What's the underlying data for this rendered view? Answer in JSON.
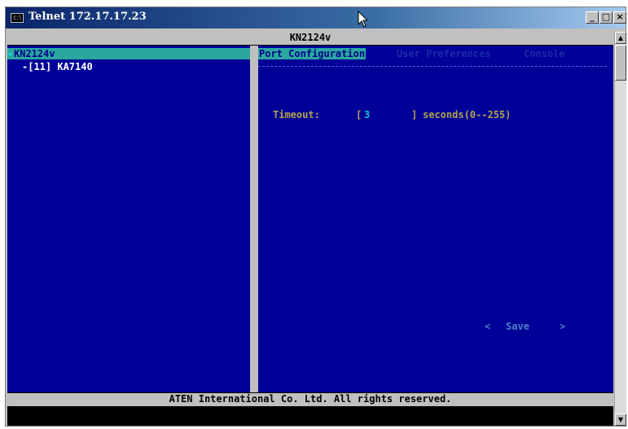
{
  "window": {
    "title": "Telnet 172.17.17.23",
    "icon_text": "c:\\",
    "controls": {
      "minimize": "_",
      "maximize": "□",
      "close": "×"
    }
  },
  "header": {
    "title": "KN2124v"
  },
  "tree": {
    "root_marker": "-",
    "root_label": "KN2124v",
    "child_label": "-[11] KA7140"
  },
  "tabs": {
    "active": "Port Configuration",
    "user": "User Preferences",
    "console": "Console"
  },
  "settings": {
    "timeout_label": "Timeout:",
    "bracket_open": "[",
    "timeout_value": "3",
    "bracket_close": "]",
    "timeout_range": "seconds(0--255)"
  },
  "actions": {
    "left_arrow": "<",
    "save_label": "Save",
    "right_arrow": ">"
  },
  "footer": {
    "copyright": "ATEN International Co. Ltd. All rights reserved."
  },
  "scrollbar": {
    "up": "▲",
    "down": "▼"
  },
  "colors": {
    "title_gradient_start": "#0a246a",
    "pane_background": "#000099",
    "highlight": "#2aa8a0",
    "label_gold": "#b3a24a",
    "value_cyan": "#00c8c8",
    "bar_gray": "#c0c0c0"
  }
}
